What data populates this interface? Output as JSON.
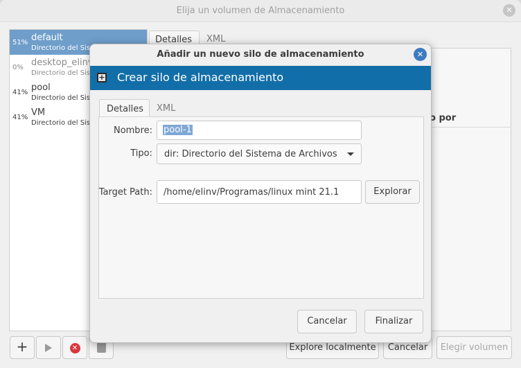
{
  "parent_window": {
    "title": "Elija un volumen de Almacenamiento",
    "close_glyph": "✕",
    "pools": [
      {
        "pct": "51%",
        "name": "default",
        "type": "Directorio del Sis",
        "selected": true,
        "active": true
      },
      {
        "pct": "0%",
        "name": "desktop_elinv",
        "type": "Directorio del Sis",
        "selected": false,
        "active": false
      },
      {
        "pct": "41%",
        "name": "pool",
        "type": "Directorio del Sis",
        "selected": false,
        "active": true
      },
      {
        "pct": "41%",
        "name": "VM",
        "type": "Directorio del Sis",
        "selected": false,
        "active": true
      }
    ],
    "tabs": [
      "Detalles",
      "XML"
    ],
    "column_header_fragment": "o por",
    "buttons": {
      "explore_local": "Explore localmente",
      "cancel": "Cancelar",
      "choose_volume": "Elegir volumen"
    },
    "toolbar_icons": [
      "add-icon",
      "play-icon",
      "stop-icon",
      "trash-icon"
    ]
  },
  "dialog": {
    "title": "Añadir un nuevo silo de almacenamiento",
    "close_glyph": "✕",
    "banner_title": "Crear silo de almacenamiento",
    "tabs": [
      "Detalles",
      "XML"
    ],
    "form": {
      "name_label": "Nombre:",
      "name_value": "pool-1",
      "type_label": "Tipo:",
      "type_value": "dir: Directorio del Sistema de Archivos",
      "target_label": "Target Path:",
      "target_value": "/home/elinv/Programas/linux mint 21.1",
      "browse_label": "Explorar"
    },
    "buttons": {
      "cancel": "Cancelar",
      "finish": "Finalizar"
    }
  },
  "colors": {
    "banner": "#126ea8",
    "selection": "#6f9ecb",
    "close_button": "#3d7bc0",
    "stop_icon": "#d9363e"
  }
}
